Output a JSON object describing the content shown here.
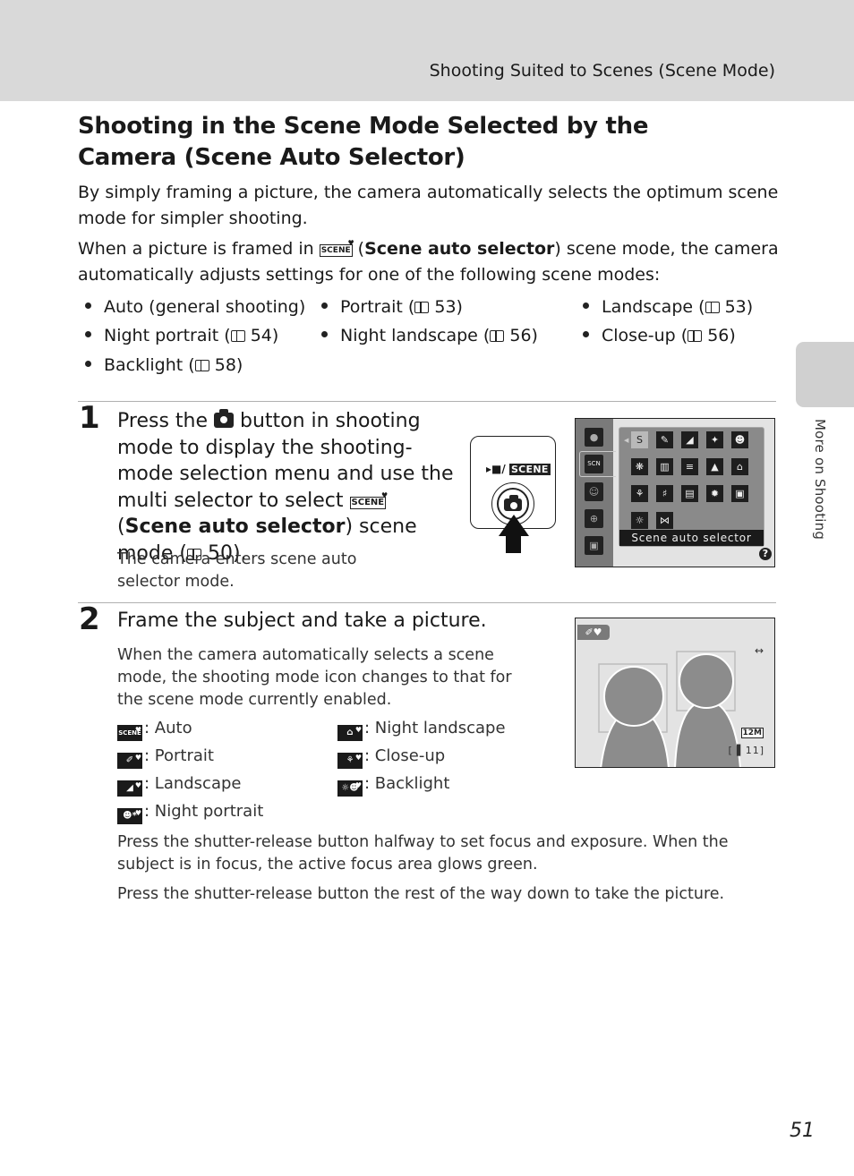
{
  "header": {
    "running_head": "Shooting Suited to Scenes (Scene Mode)"
  },
  "side_tab": {
    "label": "More on Shooting"
  },
  "title": "Shooting in the Scene Mode Selected by the Camera (Scene Auto Selector)",
  "intro": {
    "p1": "By simply framing a picture, the camera automatically selects the optimum scene mode for simpler shooting.",
    "p2_before": "When a picture is framed in ",
    "p2_icon": "SCENE",
    "p2_open": " (",
    "p2_bold": "Scene auto selector",
    "p2_after": ") scene mode, the camera automatically adjusts settings for one of the following scene modes:"
  },
  "scene_modes": [
    {
      "label": "Auto (general shooting)",
      "page": ""
    },
    {
      "label": "Portrait (",
      "page": " 53)"
    },
    {
      "label": "Landscape (",
      "page": " 53)"
    },
    {
      "label": "Night portrait (",
      "page": " 54)"
    },
    {
      "label": "Night landscape (",
      "page": " 56)"
    },
    {
      "label": "Close-up (",
      "page": " 56)"
    },
    {
      "label": "Backlight (",
      "page": " 58)"
    }
  ],
  "step1": {
    "number": "1",
    "t1": "Press the ",
    "t2": " button in shooting mode to display the shooting-mode selection menu and use the multi selector to select ",
    "t3": " (",
    "bold": "Scene auto selector",
    "t4": ") scene mode (",
    "t5": " 50).",
    "sub": "The camera enters scene auto selector mode.",
    "button_illustration": {
      "movie_symbol": "▸■",
      "scene_label": "SCENE",
      "slash": "/"
    },
    "menu_screen": {
      "caption": "Scene auto selector",
      "help": "?",
      "rail_icons": [
        "camera-icon",
        "scene-auto-icon",
        "smart-portrait-icon",
        "subject-tracking-icon",
        "movie-icon"
      ],
      "grid_icons": [
        [
          "scene-auto",
          "portrait",
          "landscape",
          "sports",
          "night-portrait"
        ],
        [
          "party-indoor",
          "beach",
          "snow",
          "sunset",
          "night-landscape"
        ],
        [
          "close-up",
          "food",
          "museum",
          "fireworks",
          "copy"
        ],
        [
          "backlight",
          "panorama"
        ]
      ]
    }
  },
  "step2": {
    "number": "2",
    "title": "Frame the subject and take a picture.",
    "desc": "When the camera automatically selects a scene mode, the shooting mode icon changes to that for the scene mode currently enabled.",
    "legend": [
      {
        "icon": "SCENE",
        "label": ": Auto"
      },
      {
        "icon": "✐",
        "label": ": Portrait"
      },
      {
        "icon": "◢",
        "label": ": Landscape"
      },
      {
        "icon": "☻*",
        "label": ": Night portrait"
      },
      {
        "icon": "⌂",
        "label": ": Night landscape"
      },
      {
        "icon": "⚘",
        "label": ": Close-up"
      },
      {
        "icon": "☼☻",
        "label": ": Backlight"
      }
    ],
    "viewfinder": {
      "mode_icon": "✐♥",
      "vr_icon": "↔",
      "image_size": "12M",
      "remaining": "[▐ 11]"
    },
    "p1": "Press the shutter-release button halfway to set focus and exposure. When the subject is in focus, the active focus area glows green.",
    "p2": "Press the shutter-release button the rest of the way down to take the picture."
  },
  "page_number": "51"
}
